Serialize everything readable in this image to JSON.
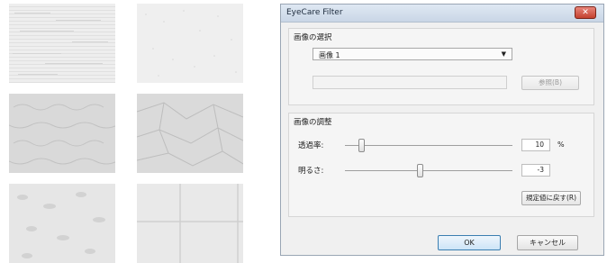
{
  "textures": [
    {
      "name": "horizontal-stripes"
    },
    {
      "name": "fine-speckle"
    },
    {
      "name": "embossed-grain"
    },
    {
      "name": "crumpled-paper"
    },
    {
      "name": "rough-plaster"
    },
    {
      "name": "tile-grid"
    }
  ],
  "dialog": {
    "title": "EyeCare Filter",
    "close_icon": "close-icon",
    "image_group": {
      "title": "画像の選択",
      "selected_image": "画像 1",
      "path_value": "",
      "browse_label": "参照(B)"
    },
    "adjust_group": {
      "title": "画像の調整",
      "transparency_label": "透過率:",
      "transparency_value": "10",
      "transparency_unit": "%",
      "transparency_level": 0.1,
      "brightness_label": "明るさ:",
      "brightness_value": "-3",
      "brightness_level": 0.45,
      "reset_label": "規定値に戻す(R)"
    },
    "ok_label": "OK",
    "cancel_label": "キャンセル"
  }
}
